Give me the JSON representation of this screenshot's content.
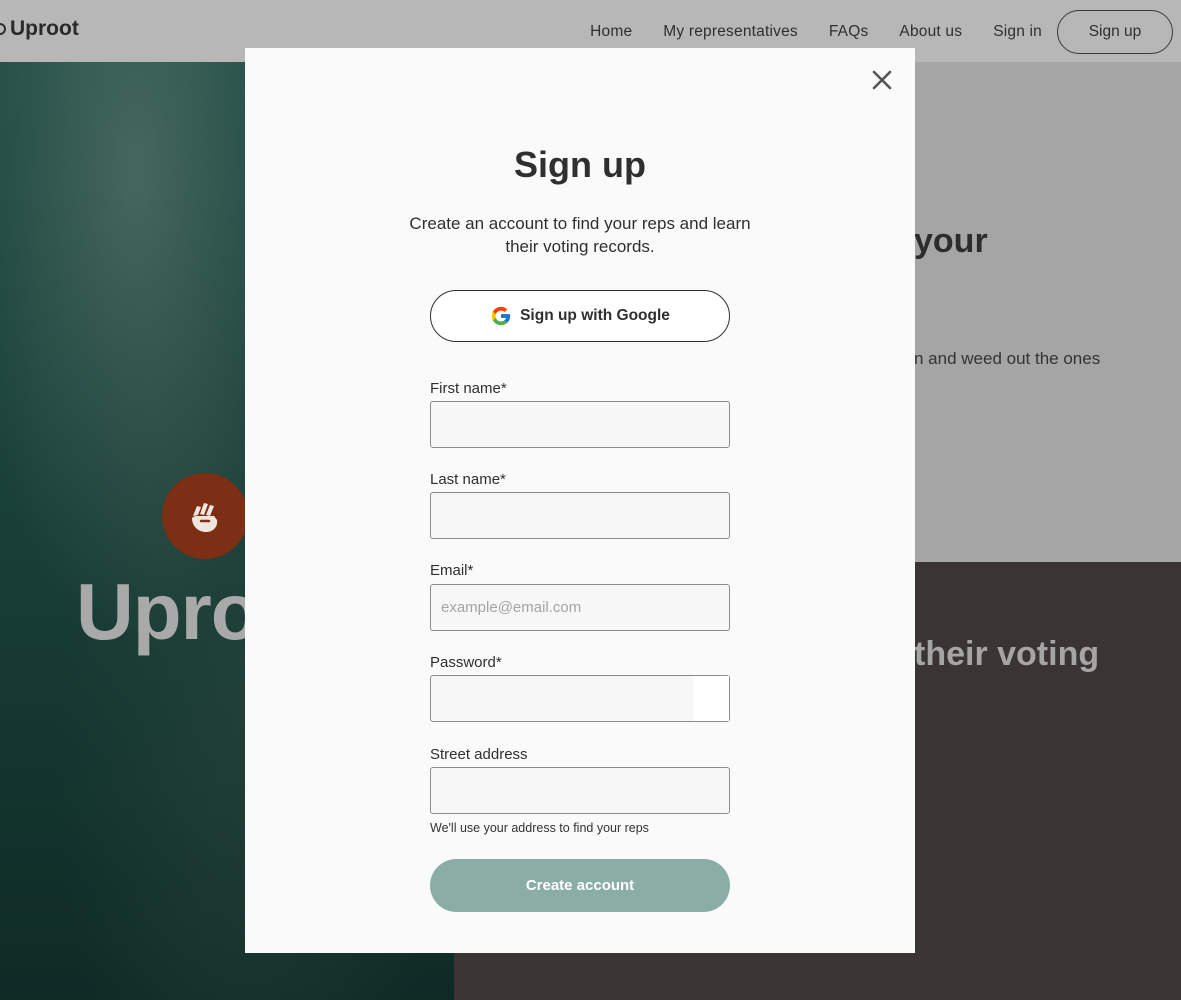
{
  "nav": {
    "brand": "Uproot",
    "links": [
      "Home",
      "My representatives",
      "FAQs",
      "About us",
      "Sign in"
    ],
    "signup": "Sign up"
  },
  "background": {
    "hero_title": "Uproo",
    "heading_1": "your",
    "text_1": "n and weed out the ones",
    "heading_2": "their voting"
  },
  "modal": {
    "title": "Sign up",
    "subtitle": "Create an account to find your reps and learn their voting records.",
    "google_button": "Sign up with Google",
    "fields": {
      "first_name": {
        "label": "First name*",
        "placeholder": ""
      },
      "last_name": {
        "label": "Last name*",
        "placeholder": ""
      },
      "email": {
        "label": "Email*",
        "placeholder": "example@email.com"
      },
      "password": {
        "label": "Password*",
        "placeholder": ""
      },
      "street_address": {
        "label": "Street address",
        "placeholder": ""
      }
    },
    "address_hint": "We'll use your address to find your reps",
    "submit": "Create account"
  },
  "colors": {
    "accent": "#8aaea6",
    "hero_green": "#1f4a42",
    "badge": "#7c2f14"
  }
}
